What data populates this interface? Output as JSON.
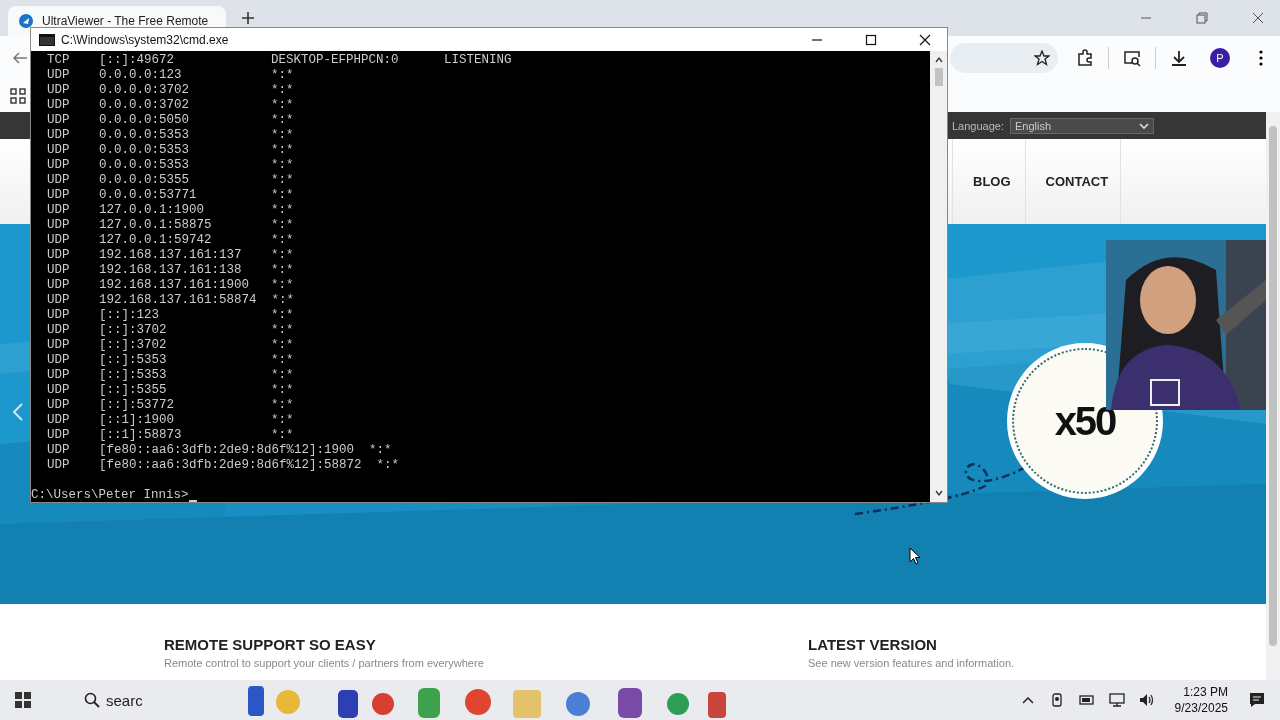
{
  "browser": {
    "tab_title": "UltraViewer - The Free Remote",
    "avatar": "P"
  },
  "site": {
    "language_label": "Language:",
    "language": "English",
    "nav": [
      "BLOG",
      "CONTACT"
    ],
    "badge": "x50",
    "sections": [
      {
        "title": "REMOTE SUPPORT SO EASY",
        "text": "Remote control to support your clients / partners from everywhere"
      },
      {
        "title": "LATEST VERSION",
        "text": "See new version features and information."
      }
    ]
  },
  "console": {
    "title": "C:\\Windows\\system32\\cmd.exe",
    "rows": [
      {
        "proto": "TCP",
        "local": "[::]:49672",
        "foreign": "DESKTOP-EFPHPCN:0",
        "state": "LISTENING"
      },
      {
        "proto": "UDP",
        "local": "0.0.0.0:123",
        "foreign": "*:*"
      },
      {
        "proto": "UDP",
        "local": "0.0.0.0:3702",
        "foreign": "*:*"
      },
      {
        "proto": "UDP",
        "local": "0.0.0.0:3702",
        "foreign": "*:*"
      },
      {
        "proto": "UDP",
        "local": "0.0.0.0:5050",
        "foreign": "*:*"
      },
      {
        "proto": "UDP",
        "local": "0.0.0.0:5353",
        "foreign": "*:*"
      },
      {
        "proto": "UDP",
        "local": "0.0.0.0:5353",
        "foreign": "*:*"
      },
      {
        "proto": "UDP",
        "local": "0.0.0.0:5353",
        "foreign": "*:*"
      },
      {
        "proto": "UDP",
        "local": "0.0.0.0:5355",
        "foreign": "*:*"
      },
      {
        "proto": "UDP",
        "local": "0.0.0.0:53771",
        "foreign": "*:*"
      },
      {
        "proto": "UDP",
        "local": "127.0.0.1:1900",
        "foreign": "*:*"
      },
      {
        "proto": "UDP",
        "local": "127.0.0.1:58875",
        "foreign": "*:*"
      },
      {
        "proto": "UDP",
        "local": "127.0.0.1:59742",
        "foreign": "*:*"
      },
      {
        "proto": "UDP",
        "local": "192.168.137.161:137",
        "foreign": "*:*"
      },
      {
        "proto": "UDP",
        "local": "192.168.137.161:138",
        "foreign": "*:*"
      },
      {
        "proto": "UDP",
        "local": "192.168.137.161:1900",
        "foreign": "*:*"
      },
      {
        "proto": "UDP",
        "local": "192.168.137.161:58874",
        "foreign": "*:*"
      },
      {
        "proto": "UDP",
        "local": "[::]:123",
        "foreign": "*:*"
      },
      {
        "proto": "UDP",
        "local": "[::]:3702",
        "foreign": "*:*"
      },
      {
        "proto": "UDP",
        "local": "[::]:3702",
        "foreign": "*:*"
      },
      {
        "proto": "UDP",
        "local": "[::]:5353",
        "foreign": "*:*"
      },
      {
        "proto": "UDP",
        "local": "[::]:5353",
        "foreign": "*:*"
      },
      {
        "proto": "UDP",
        "local": "[::]:5355",
        "foreign": "*:*"
      },
      {
        "proto": "UDP",
        "local": "[::]:53772",
        "foreign": "*:*"
      },
      {
        "proto": "UDP",
        "local": "[::1]:1900",
        "foreign": "*:*"
      },
      {
        "proto": "UDP",
        "local": "[::1]:58873",
        "foreign": "*:*"
      },
      {
        "proto": "UDP",
        "local": "[fe80::aa6:3dfb:2de9:8d6f%12]:1900",
        "foreign": "*:*"
      },
      {
        "proto": "UDP",
        "local": "[fe80::aa6:3dfb:2de9:8d6f%12]:58872",
        "foreign": "*:*"
      }
    ],
    "prompt": "C:\\Users\\Peter Innis>"
  },
  "taskbar": {
    "search": "searc",
    "time": "1:23 PM",
    "date": "9/23/2025"
  }
}
